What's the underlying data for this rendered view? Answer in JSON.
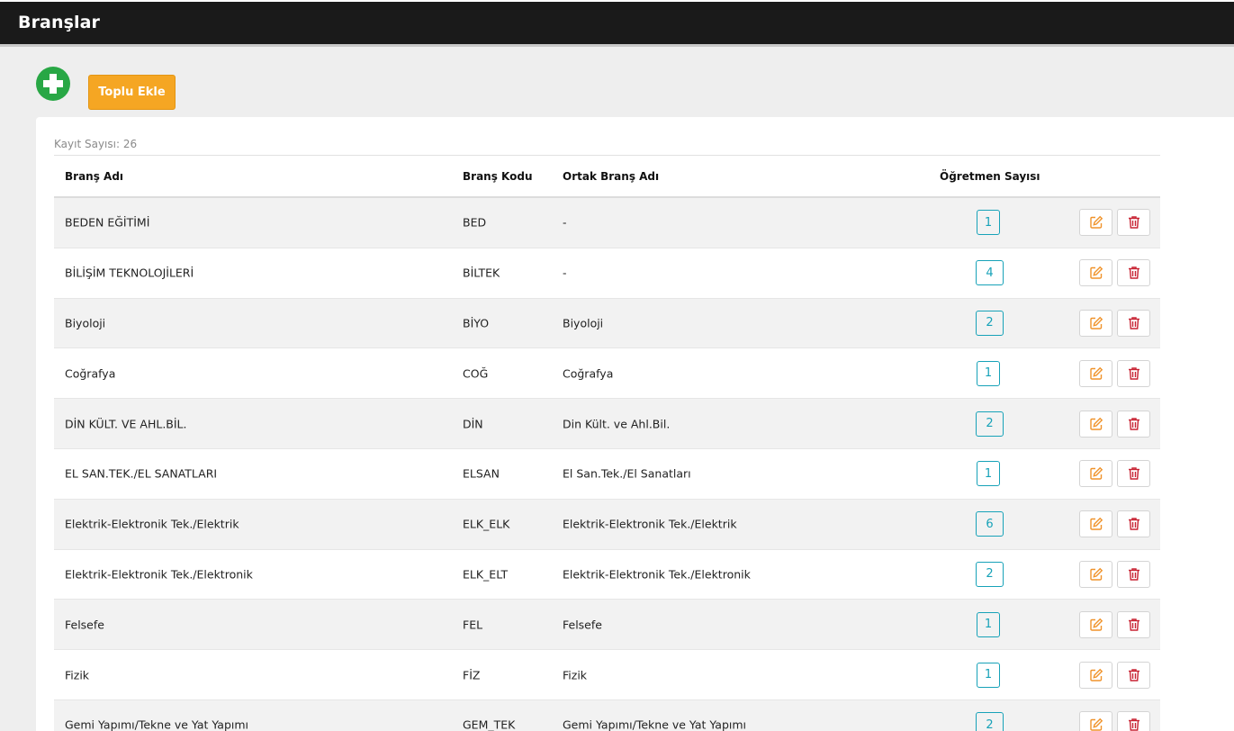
{
  "header": {
    "title": "Branşlar"
  },
  "toolbar": {
    "add_icon": "plus-circle-icon",
    "bulk_add_label": "Toplu Ekle"
  },
  "list": {
    "record_count_label": "Kayıt Sayısı: 26",
    "columns": [
      "Branş Adı",
      "Branş Kodu",
      "Ortak Branş Adı",
      "Öğretmen Sayısı"
    ],
    "rows": [
      {
        "name": "BEDEN EĞİTİMİ",
        "code": "BED",
        "common": "-",
        "teachers": "1"
      },
      {
        "name": "BİLİŞİM TEKNOLOJİLERİ",
        "code": "BİLTEK",
        "common": "-",
        "teachers": "4"
      },
      {
        "name": "Biyoloji",
        "code": "BİYO",
        "common": "Biyoloji",
        "teachers": "2"
      },
      {
        "name": "Coğrafya",
        "code": "COĞ",
        "common": "Coğrafya",
        "teachers": "1"
      },
      {
        "name": "DİN KÜLT. VE AHL.BİL.",
        "code": "DİN",
        "common": "Din Kült. ve Ahl.Bil.",
        "teachers": "2"
      },
      {
        "name": "EL SAN.TEK./EL SANATLARI",
        "code": "ELSAN",
        "common": "El San.Tek./El Sanatları",
        "teachers": "1"
      },
      {
        "name": "Elektrik-Elektronik Tek./Elektrik",
        "code": "ELK_ELK",
        "common": "Elektrik-Elektronik Tek./Elektrik",
        "teachers": "6"
      },
      {
        "name": "Elektrik-Elektronik Tek./Elektronik",
        "code": "ELK_ELT",
        "common": "Elektrik-Elektronik Tek./Elektronik",
        "teachers": "2"
      },
      {
        "name": "Felsefe",
        "code": "FEL",
        "common": "Felsefe",
        "teachers": "1"
      },
      {
        "name": "Fizik",
        "code": "FİZ",
        "common": "Fizik",
        "teachers": "1"
      },
      {
        "name": "Gemi Yapımı/Tekne ve Yat Yapımı",
        "code": "GEM_TEK",
        "common": "Gemi Yapımı/Tekne ve Yat Yapımı",
        "teachers": "2"
      }
    ],
    "row_actions": {
      "edit_icon": "edit-icon",
      "delete_icon": "trash-icon"
    }
  },
  "colors": {
    "header_bg": "#1a1a1a",
    "add_green": "#28a745",
    "bulk_orange": "#f5a623",
    "badge_teal": "#17a2b8",
    "edit_orange": "#f0932b",
    "delete_red": "#c82333"
  }
}
